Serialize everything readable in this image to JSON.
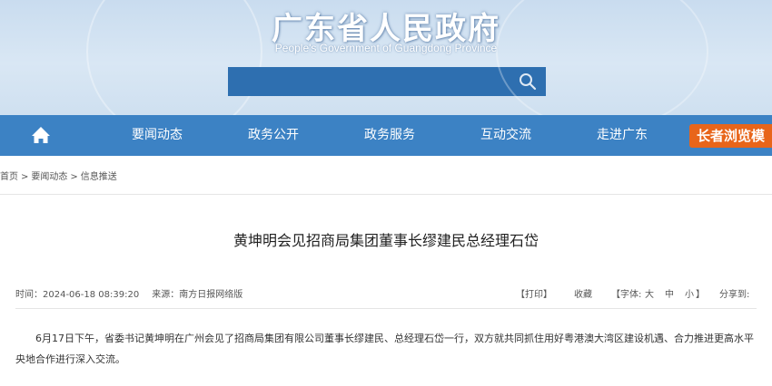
{
  "header": {
    "title": "广东省人民政府",
    "subtitle": "People's Government of Guangdong Province",
    "search_placeholder": ""
  },
  "nav": {
    "home_icon": "home-icon",
    "items": [
      "要闻动态",
      "政务公开",
      "政务服务",
      "互动交流",
      "走进广东"
    ],
    "elder_mode": "长者浏览模"
  },
  "breadcrumb": [
    "首页",
    "要闻动态",
    "信息推送"
  ],
  "article": {
    "title": "黄坤明会见招商局集团董事长缪建民总经理石岱",
    "time": "时间：2024-06-18 08:39:20",
    "source": "来源：南方日报网络版",
    "print": "【打印】",
    "favorite": "收藏",
    "font_label": "【字体:",
    "font_large": "大",
    "font_medium": "中",
    "font_small": "小",
    "font_close": "】",
    "share": "分享到:",
    "body": "6月17日下午，省委书记黄坤明在广州会见了招商局集团有限公司董事长缪建民、总经理石岱一行，双方就共同抓住用好粤港澳大湾区建设机遇、合力推进更高水平央地合作进行深入交流。"
  },
  "colors": {
    "nav": "#3c82c4",
    "search": "#2e6fb0",
    "elder": "#e8651a"
  }
}
